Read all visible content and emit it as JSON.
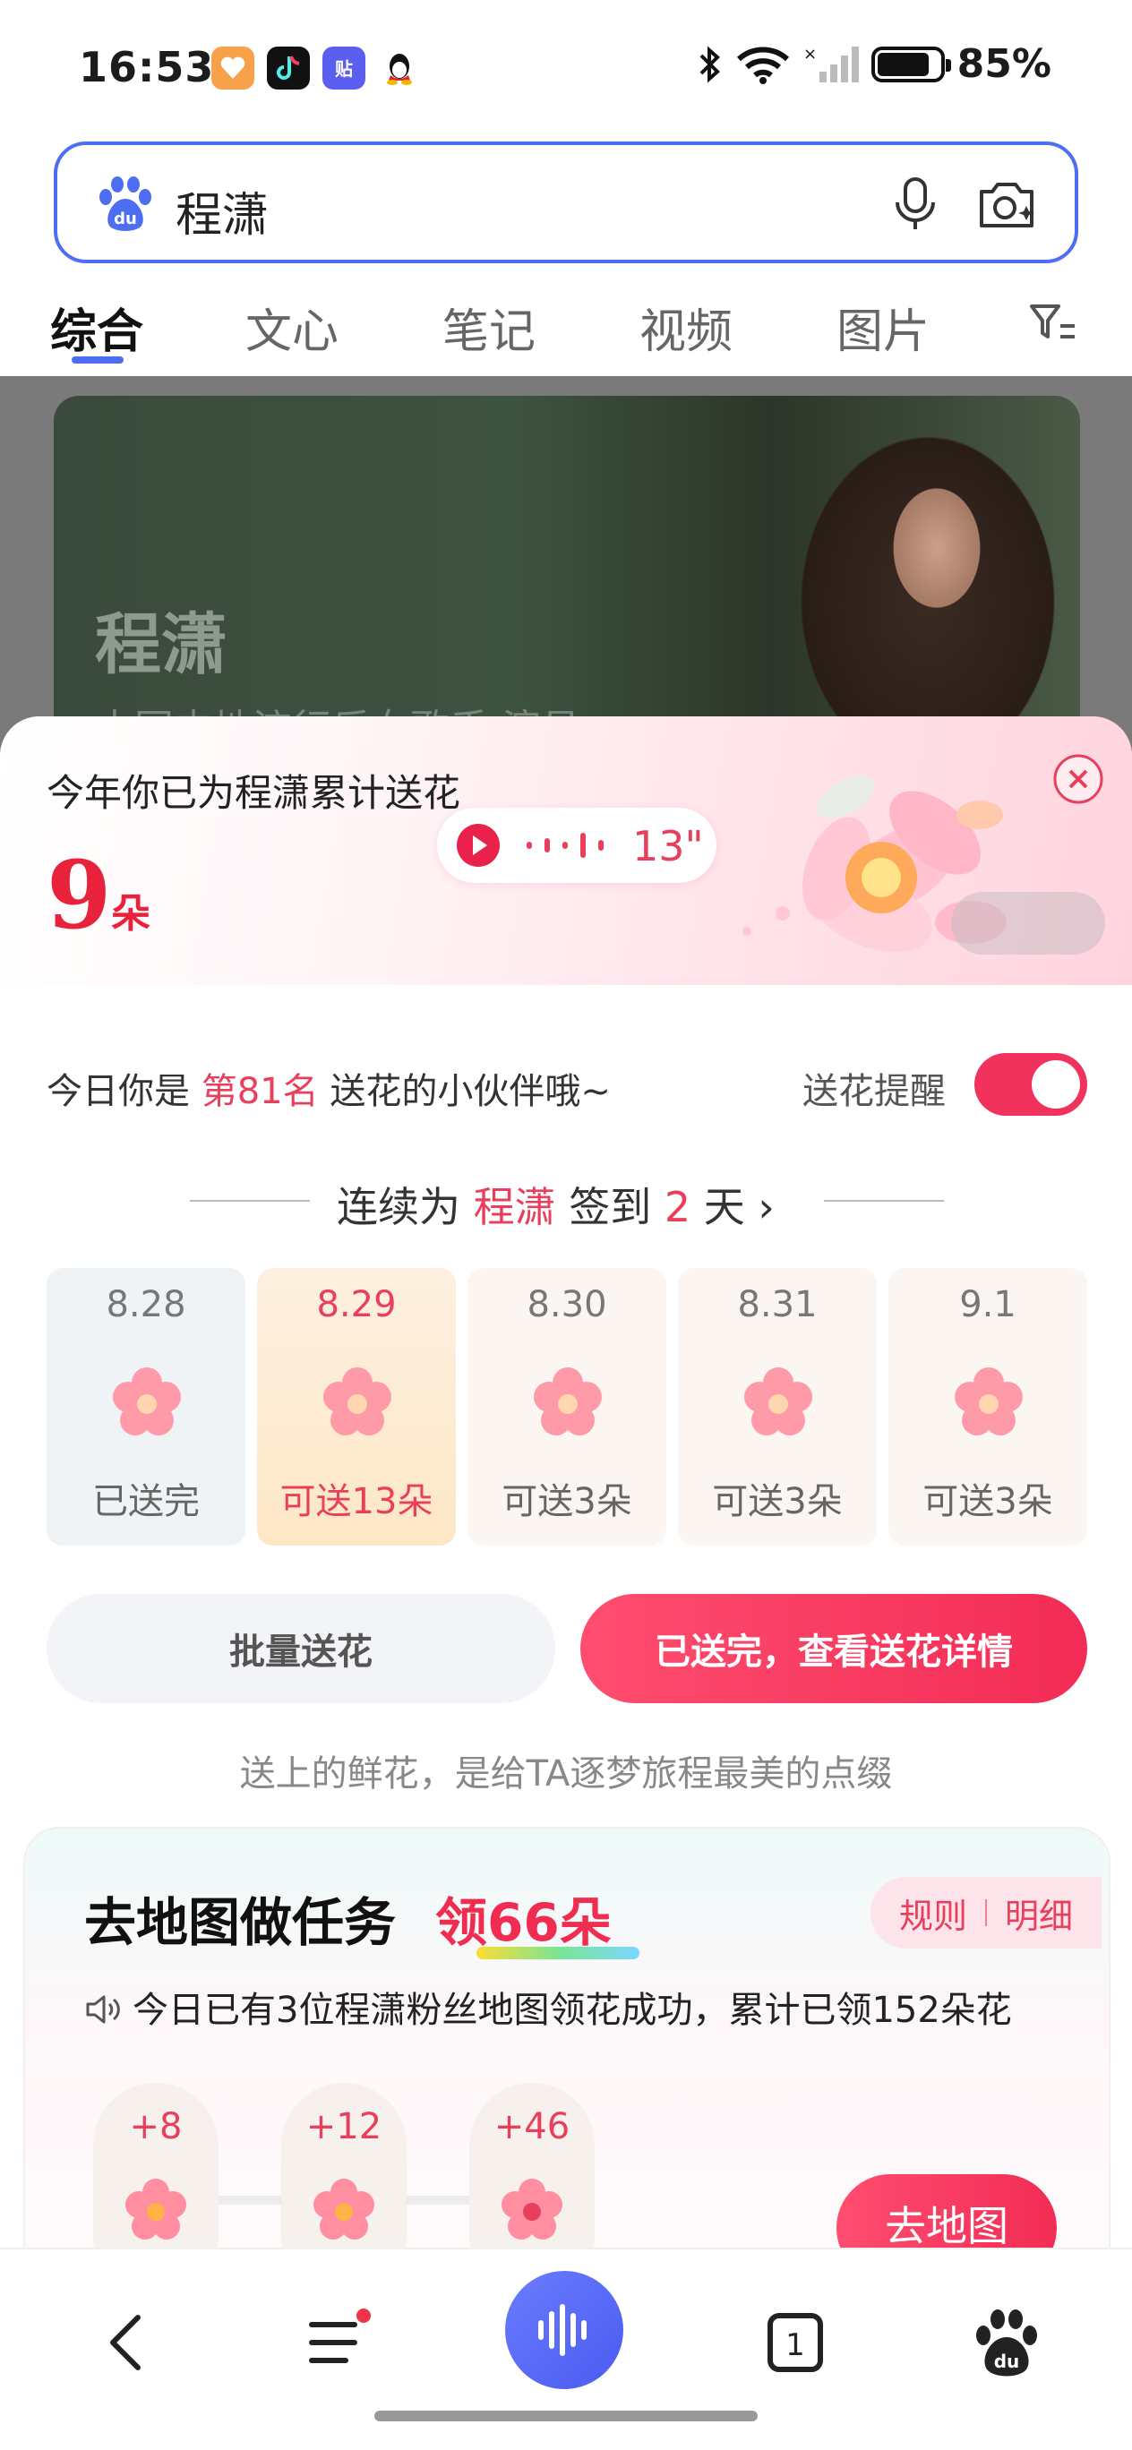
{
  "status_bar": {
    "time": "16:53",
    "battery": "85%",
    "app_icons": [
      {
        "name": "health-app-icon",
        "glyph": "♥",
        "color": "#f7a14a"
      },
      {
        "name": "douyin-app-icon",
        "glyph": "♪",
        "color": "#111111"
      },
      {
        "name": "tieba-app-icon",
        "glyph": "贴",
        "color": "#5b5ff0"
      },
      {
        "name": "qq-app-icon",
        "glyph": "",
        "color": "#ffffff"
      }
    ]
  },
  "search": {
    "query": "程潇"
  },
  "tabs": [
    {
      "label": "综合",
      "active": true
    },
    {
      "label": "文心",
      "active": false
    },
    {
      "label": "笔记",
      "active": false
    },
    {
      "label": "视频",
      "active": false
    },
    {
      "label": "图片",
      "active": false
    }
  ],
  "result_card": {
    "title": "程潇",
    "subtitle": "中国内地流行乐女歌手 演员"
  },
  "flower_sheet": {
    "header_line": "今年你已为程潇累计送花",
    "count": "9",
    "count_unit": "朵",
    "audio_duration": "13\"",
    "rank_prefix": "今日你是",
    "rank_value": "第81名",
    "rank_suffix": "送花的小伙伴哦~",
    "reminder_label": "送花提醒",
    "reminder_on": true,
    "streak_prefix": "连续为",
    "streak_name": "程潇",
    "streak_mid": "签到",
    "streak_days": "2",
    "streak_suffix": "天 ›",
    "days": [
      {
        "date": "8.28",
        "label": "已送完",
        "state": "done"
      },
      {
        "date": "8.29",
        "label": "可送13朵",
        "state": "today"
      },
      {
        "date": "8.30",
        "label": "可送3朵",
        "state": "future"
      },
      {
        "date": "8.31",
        "label": "可送3朵",
        "state": "future"
      },
      {
        "date": "9.1",
        "label": "可送3朵",
        "state": "future"
      }
    ],
    "batch_button": "批量送花",
    "detail_button": "已送完，查看送花详情",
    "tagline": "送上的鲜花，是给TA逐梦旅程最美的点缀"
  },
  "map_task": {
    "title": "去地图做任务",
    "bonus": "领66朵",
    "rules_label": "规则",
    "details_label": "明细",
    "notice": "今日已有3位程潇粉丝地图领花成功，累计已领152朵花",
    "tasks": [
      {
        "value": "+8"
      },
      {
        "value": "+12"
      },
      {
        "value": "+46"
      }
    ],
    "go_button": "去地图"
  },
  "colors": {
    "accent_blue": "#4e6ef2",
    "accent_pink": "#f02c50",
    "text_highlight": "#e8405c"
  }
}
